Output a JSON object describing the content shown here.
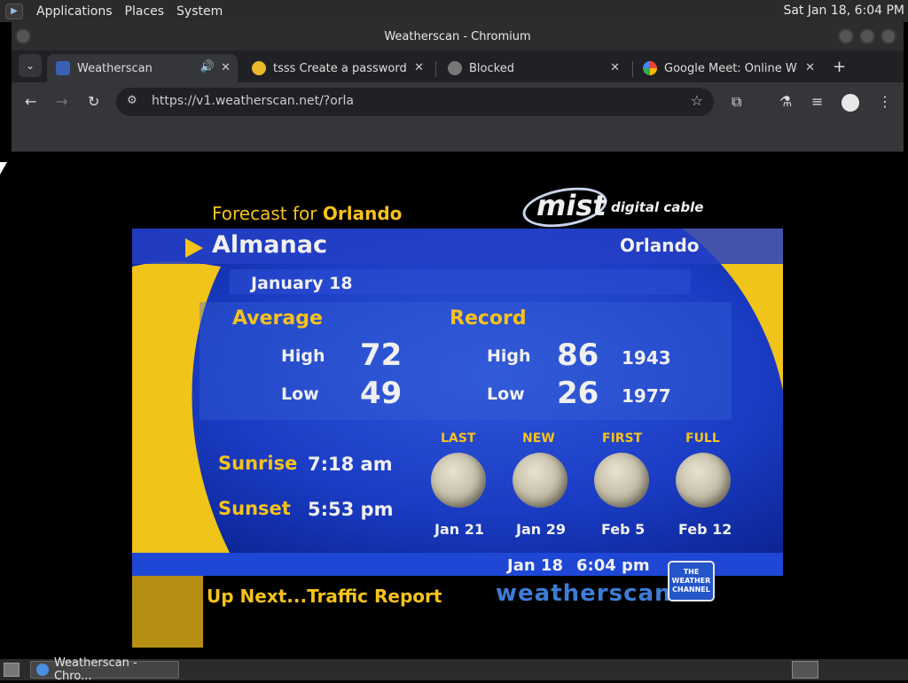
{
  "top_panel": {
    "menus": [
      "Applications",
      "Places",
      "System"
    ],
    "clock": "Sat Jan 18,  6:04 PM"
  },
  "window": {
    "title": "Weatherscan - Chromium"
  },
  "tabs": [
    {
      "title": "Weatherscan",
      "active": true,
      "audio_icon": "speaker-icon"
    },
    {
      "title": "tsss Create a password-p",
      "active": false
    },
    {
      "title": "Blocked",
      "active": false
    },
    {
      "title": "Google Meet: Online Web",
      "active": false
    }
  ],
  "toolbar": {
    "url": "https://v1.weatherscan.net/?orla"
  },
  "weatherscan": {
    "forecast_label": "Forecast for",
    "forecast_city": "Orlando",
    "sponsor_logo": "mist",
    "sponsor_tagline": "digital cable",
    "section_title": "Almanac",
    "city": "Orlando",
    "date": "January 18",
    "average": {
      "heading": "Average",
      "high_label": "High",
      "high": "72",
      "low_label": "Low",
      "low": "49"
    },
    "record": {
      "heading": "Record",
      "high_label": "High",
      "high": "86",
      "high_year": "1943",
      "low_label": "Low",
      "low": "26",
      "low_year": "1977"
    },
    "sunrise_label": "Sunrise",
    "sunrise": "7:18 am",
    "sunset_label": "Sunset",
    "sunset": "5:53 pm",
    "moon_phases": [
      {
        "phase": "LAST",
        "date": "Jan 21"
      },
      {
        "phase": "NEW",
        "date": "Jan 29"
      },
      {
        "phase": "FIRST",
        "date": "Feb 5"
      },
      {
        "phase": "FULL",
        "date": "Feb 12"
      }
    ],
    "bottom_date": "Jan 18",
    "bottom_time": "6:04 pm",
    "up_next": "Up Next...Traffic Report",
    "brand": "weatherscan",
    "twc_logo": "THE WEATHER CHANNEL"
  },
  "taskbar": {
    "window_button": "Weatherscan - Chro..."
  }
}
